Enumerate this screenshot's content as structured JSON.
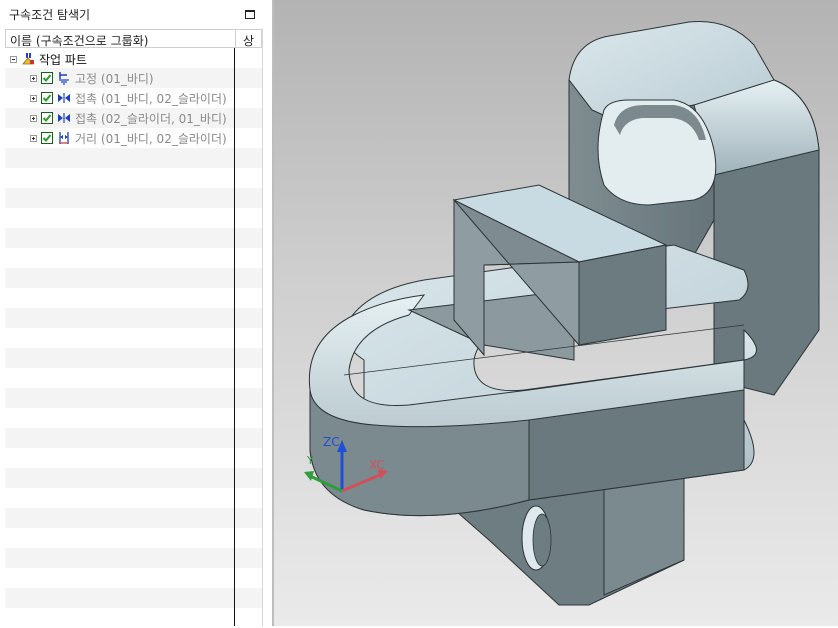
{
  "navigator": {
    "title": "구속조건 탐색기",
    "columns": {
      "name": "이름 (구속조건으로 그룹화)",
      "status": "상"
    },
    "root": {
      "label": "작업 파트"
    },
    "items": [
      {
        "label": "고정 (01_바디)",
        "icon": "fix-constraint-icon",
        "checked": true
      },
      {
        "label": "접촉 (01_바디, 02_슬라이더)",
        "icon": "touch-constraint-icon",
        "checked": true
      },
      {
        "label": "접촉 (02_슬라이더, 01_바디)",
        "icon": "touch-constraint-icon",
        "checked": true
      },
      {
        "label": "거리 (01_바디, 02_슬라이더)",
        "icon": "distance-constraint-icon",
        "checked": true
      }
    ]
  },
  "viewport": {
    "triad": {
      "z_label": "ZC",
      "x_label": "XC",
      "y_label": "Y"
    },
    "colors": {
      "z_axis": "#1f4fd6",
      "x_axis": "#d0505a",
      "y_axis": "#2e9e3a",
      "part_light": "#cddde3",
      "part_dark": "#6c7a7e"
    }
  }
}
